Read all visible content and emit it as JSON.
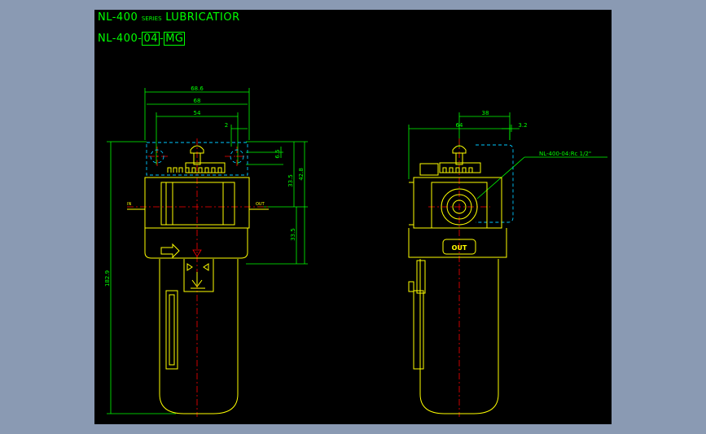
{
  "title": {
    "line1_model": "NL-400",
    "line1_series": "SERIES",
    "line1_name": "LUBRICATIOR",
    "line2_prefix": "NL-400-",
    "line2_code1": "04",
    "line2_sep": "-",
    "line2_code2": "MG"
  },
  "front_view": {
    "dims": {
      "overall_width_a": "68.6",
      "overall_width_b": "68",
      "port_spacing": "54",
      "offset": "2",
      "small_height": "6.5",
      "height_upper": "33.5",
      "height_total_top": "42.8",
      "height_lower": "33.5",
      "total_height": "182.9"
    },
    "port_in": "IN",
    "port_out": "OUT"
  },
  "side_view": {
    "dims": {
      "width": "64",
      "half_width": "38",
      "offset": "3.2"
    },
    "callout": "NL-400-04:Rc 1/2\"",
    "out_label": "OUT"
  },
  "colors": {
    "background": "#000000",
    "frame": "#8a9ab3",
    "dimension": "#00ff00",
    "body_line": "#ffff00",
    "centerline": "#ff0000",
    "hidden": "#00c8ff",
    "panel_border": "#ffffff"
  }
}
